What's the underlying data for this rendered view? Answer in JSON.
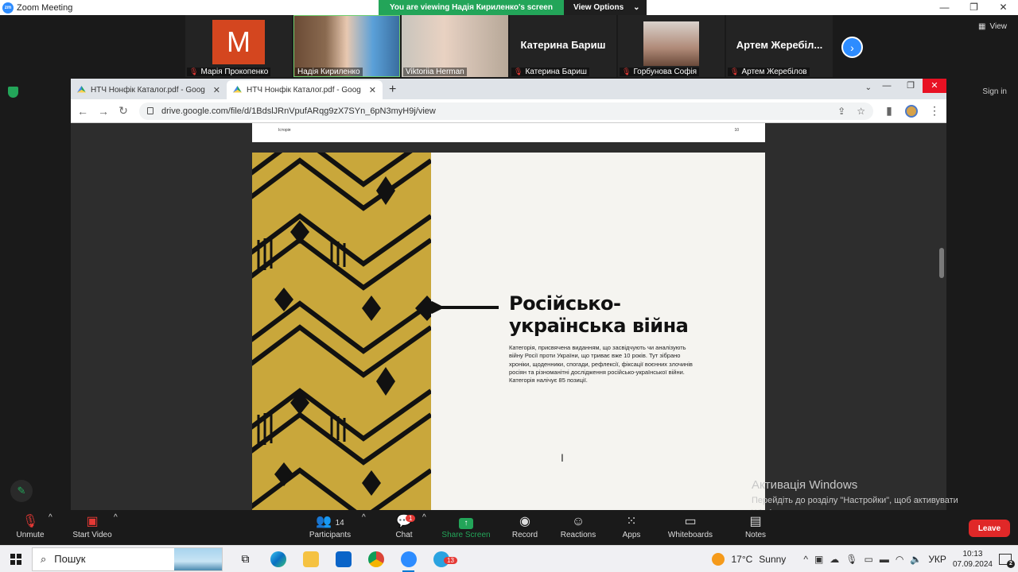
{
  "zoom_window": {
    "title": "Zoom Meeting",
    "viewing_banner": "You are viewing Надія Кириленко's screen",
    "view_options_label": "View Options",
    "view_label": "View",
    "sign_in_label": "Sign in"
  },
  "participants": [
    {
      "name": "Марія Прокопенко",
      "type": "avatar",
      "initial": "M",
      "muted": true
    },
    {
      "name": "Надія Кириленко",
      "type": "video",
      "muted": false
    },
    {
      "name": "Viktoriia Herman",
      "type": "video",
      "muted": false
    },
    {
      "name": "Катерина Бариш",
      "type": "name",
      "display_name": "Катерина Бариш",
      "muted": true
    },
    {
      "name": "Горбунова Софія",
      "type": "video",
      "muted": true
    },
    {
      "name": "Артем Жеребілов",
      "type": "name",
      "display_name": "Артем Жеребіл...",
      "muted": true
    }
  ],
  "browser": {
    "tabs": [
      {
        "label": "НТЧ Нонфік Каталог.pdf - Goog",
        "active": false
      },
      {
        "label": "НТЧ Нонфік Каталог.pdf - Goog",
        "active": true
      }
    ],
    "url": "drive.google.com/file/d/1BdslJRnVpufARqg9zX7SYn_6pN3myH9j/view"
  },
  "document": {
    "prev_page_header_left": "Історія",
    "prev_page_header_right": "10",
    "title_line1": "Російсько-",
    "title_line2": "українська війна",
    "description": "Категорія, присвячена виданням, що засвідчують чи аналізують війну Росії проти України, що триває вже 10 років. Тут зібрано хроніки, щоденники, спогади, рефлексії, фіксації воєнних злочинів росіян та різноманітні дослідження російсько-української війни. Категорія налічує 85 позиції."
  },
  "activation": {
    "line1": "Активація Windows",
    "line2": "Перейдіть до розділу \"Настройки\", щоб активувати Windows."
  },
  "toolbar": {
    "unmute": "Unmute",
    "start_video": "Start Video",
    "participants": "Participants",
    "participants_count": "14",
    "chat": "Chat",
    "chat_badge": "1",
    "share_screen": "Share Screen",
    "record": "Record",
    "reactions": "Reactions",
    "apps": "Apps",
    "whiteboards": "Whiteboards",
    "notes": "Notes",
    "leave": "Leave"
  },
  "taskbar": {
    "search_placeholder": "Пошук",
    "weather_temp": "17°C",
    "weather_desc": "Sunny",
    "language": "УКР",
    "time": "10:13",
    "date": "07.09.2024",
    "notification_count": "2",
    "telegram_badge": "13"
  },
  "colors": {
    "zoom_blue": "#2d8cff",
    "banner_green": "#23a559",
    "leave_red": "#e02828",
    "pattern_gold": "#c9a73b"
  }
}
